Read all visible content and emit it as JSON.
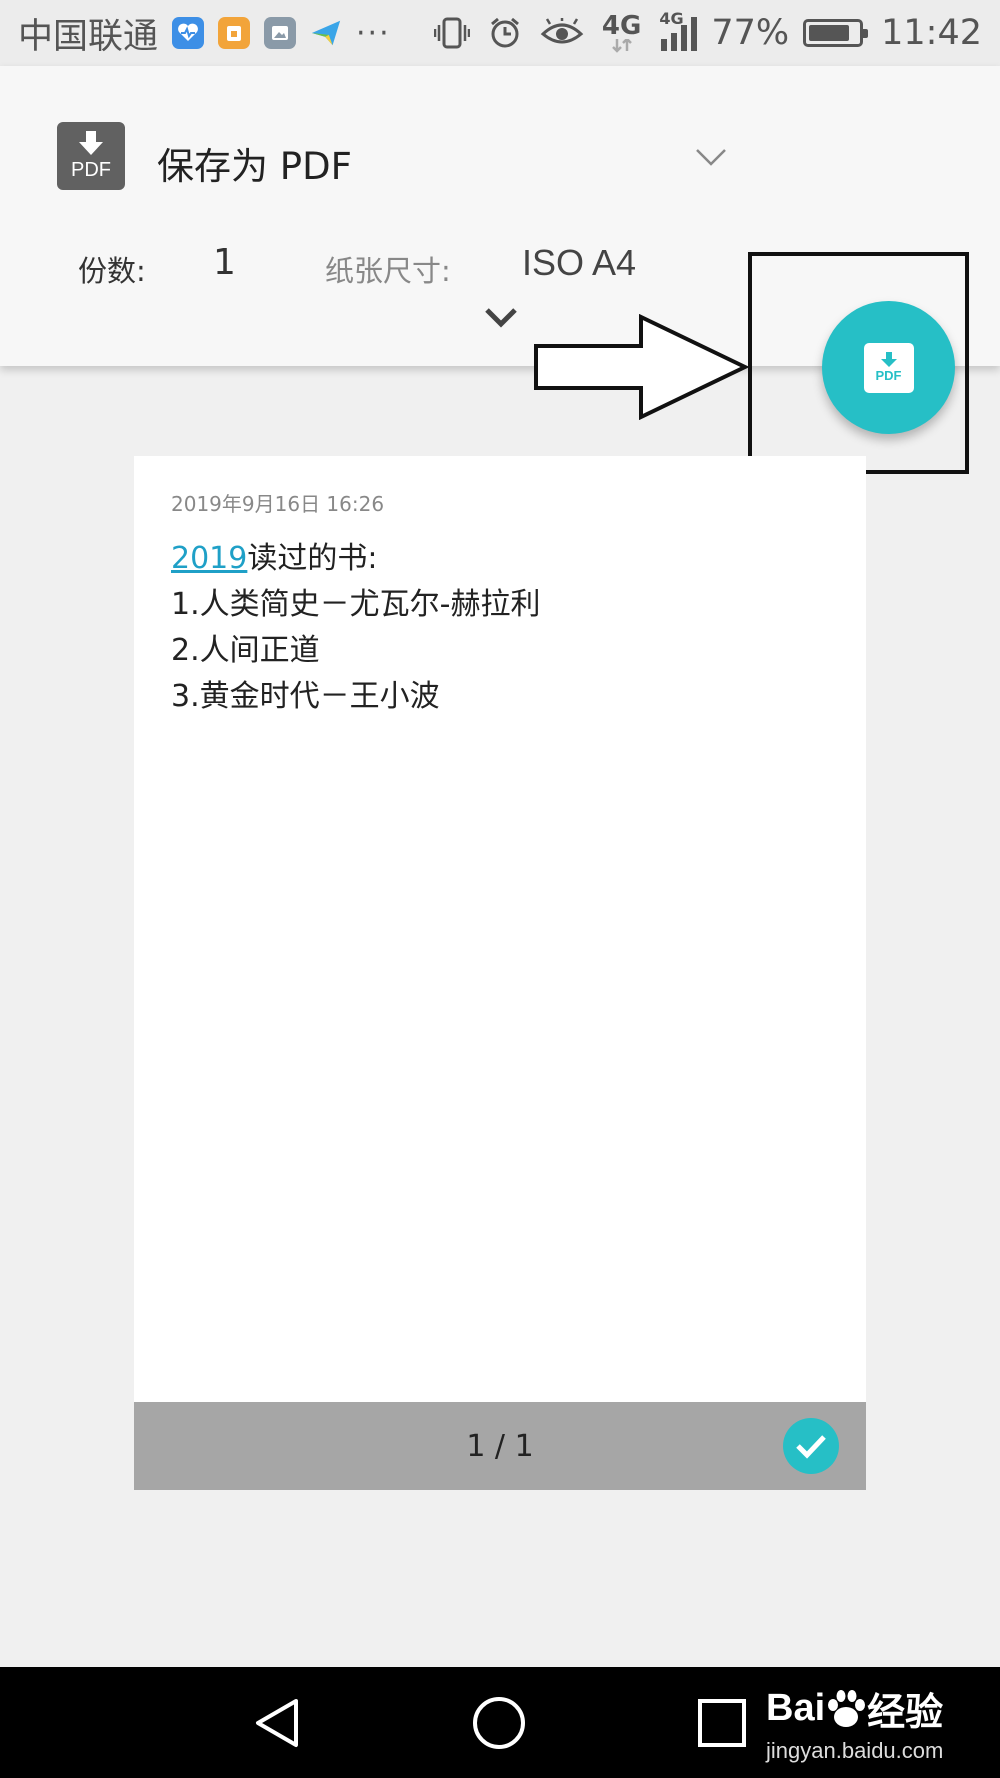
{
  "status_bar": {
    "carrier": "中国联通",
    "more": "···",
    "network": "4G",
    "network2": "4G",
    "battery": "77%",
    "time": "11:42",
    "icons": [
      "health-icon",
      "wallet-icon",
      "gallery-icon",
      "paper-plane-icon",
      "vibrate-icon",
      "alarm-icon",
      "eye-icon",
      "signal-icon",
      "battery-icon"
    ]
  },
  "header": {
    "printer_name": "保存为 PDF",
    "printer_icon_text": "PDF",
    "copies_label": "份数:",
    "copies_value": "1",
    "paper_label": "纸张尺寸:",
    "paper_value": "ISO A4"
  },
  "fab": {
    "icon_text": "PDF"
  },
  "preview": {
    "date": "2019年9月16日 16:26",
    "line1_link": "2019",
    "line1_rest": "读过的书:",
    "line2": "1.人类简史－尤瓦尔-赫拉利",
    "line3": "2.人间正道",
    "line4": "3.黄金时代－王小波",
    "page_counter": "1 / 1"
  },
  "watermark": {
    "brand_a": "Bai",
    "brand_b": "经验",
    "url": "jingyan.baidu.com"
  },
  "colors": {
    "accent": "#26bfc6",
    "link": "#1fa0c7",
    "header_bg": "#f7f7f7",
    "page_bg": "#f0f0f0"
  }
}
